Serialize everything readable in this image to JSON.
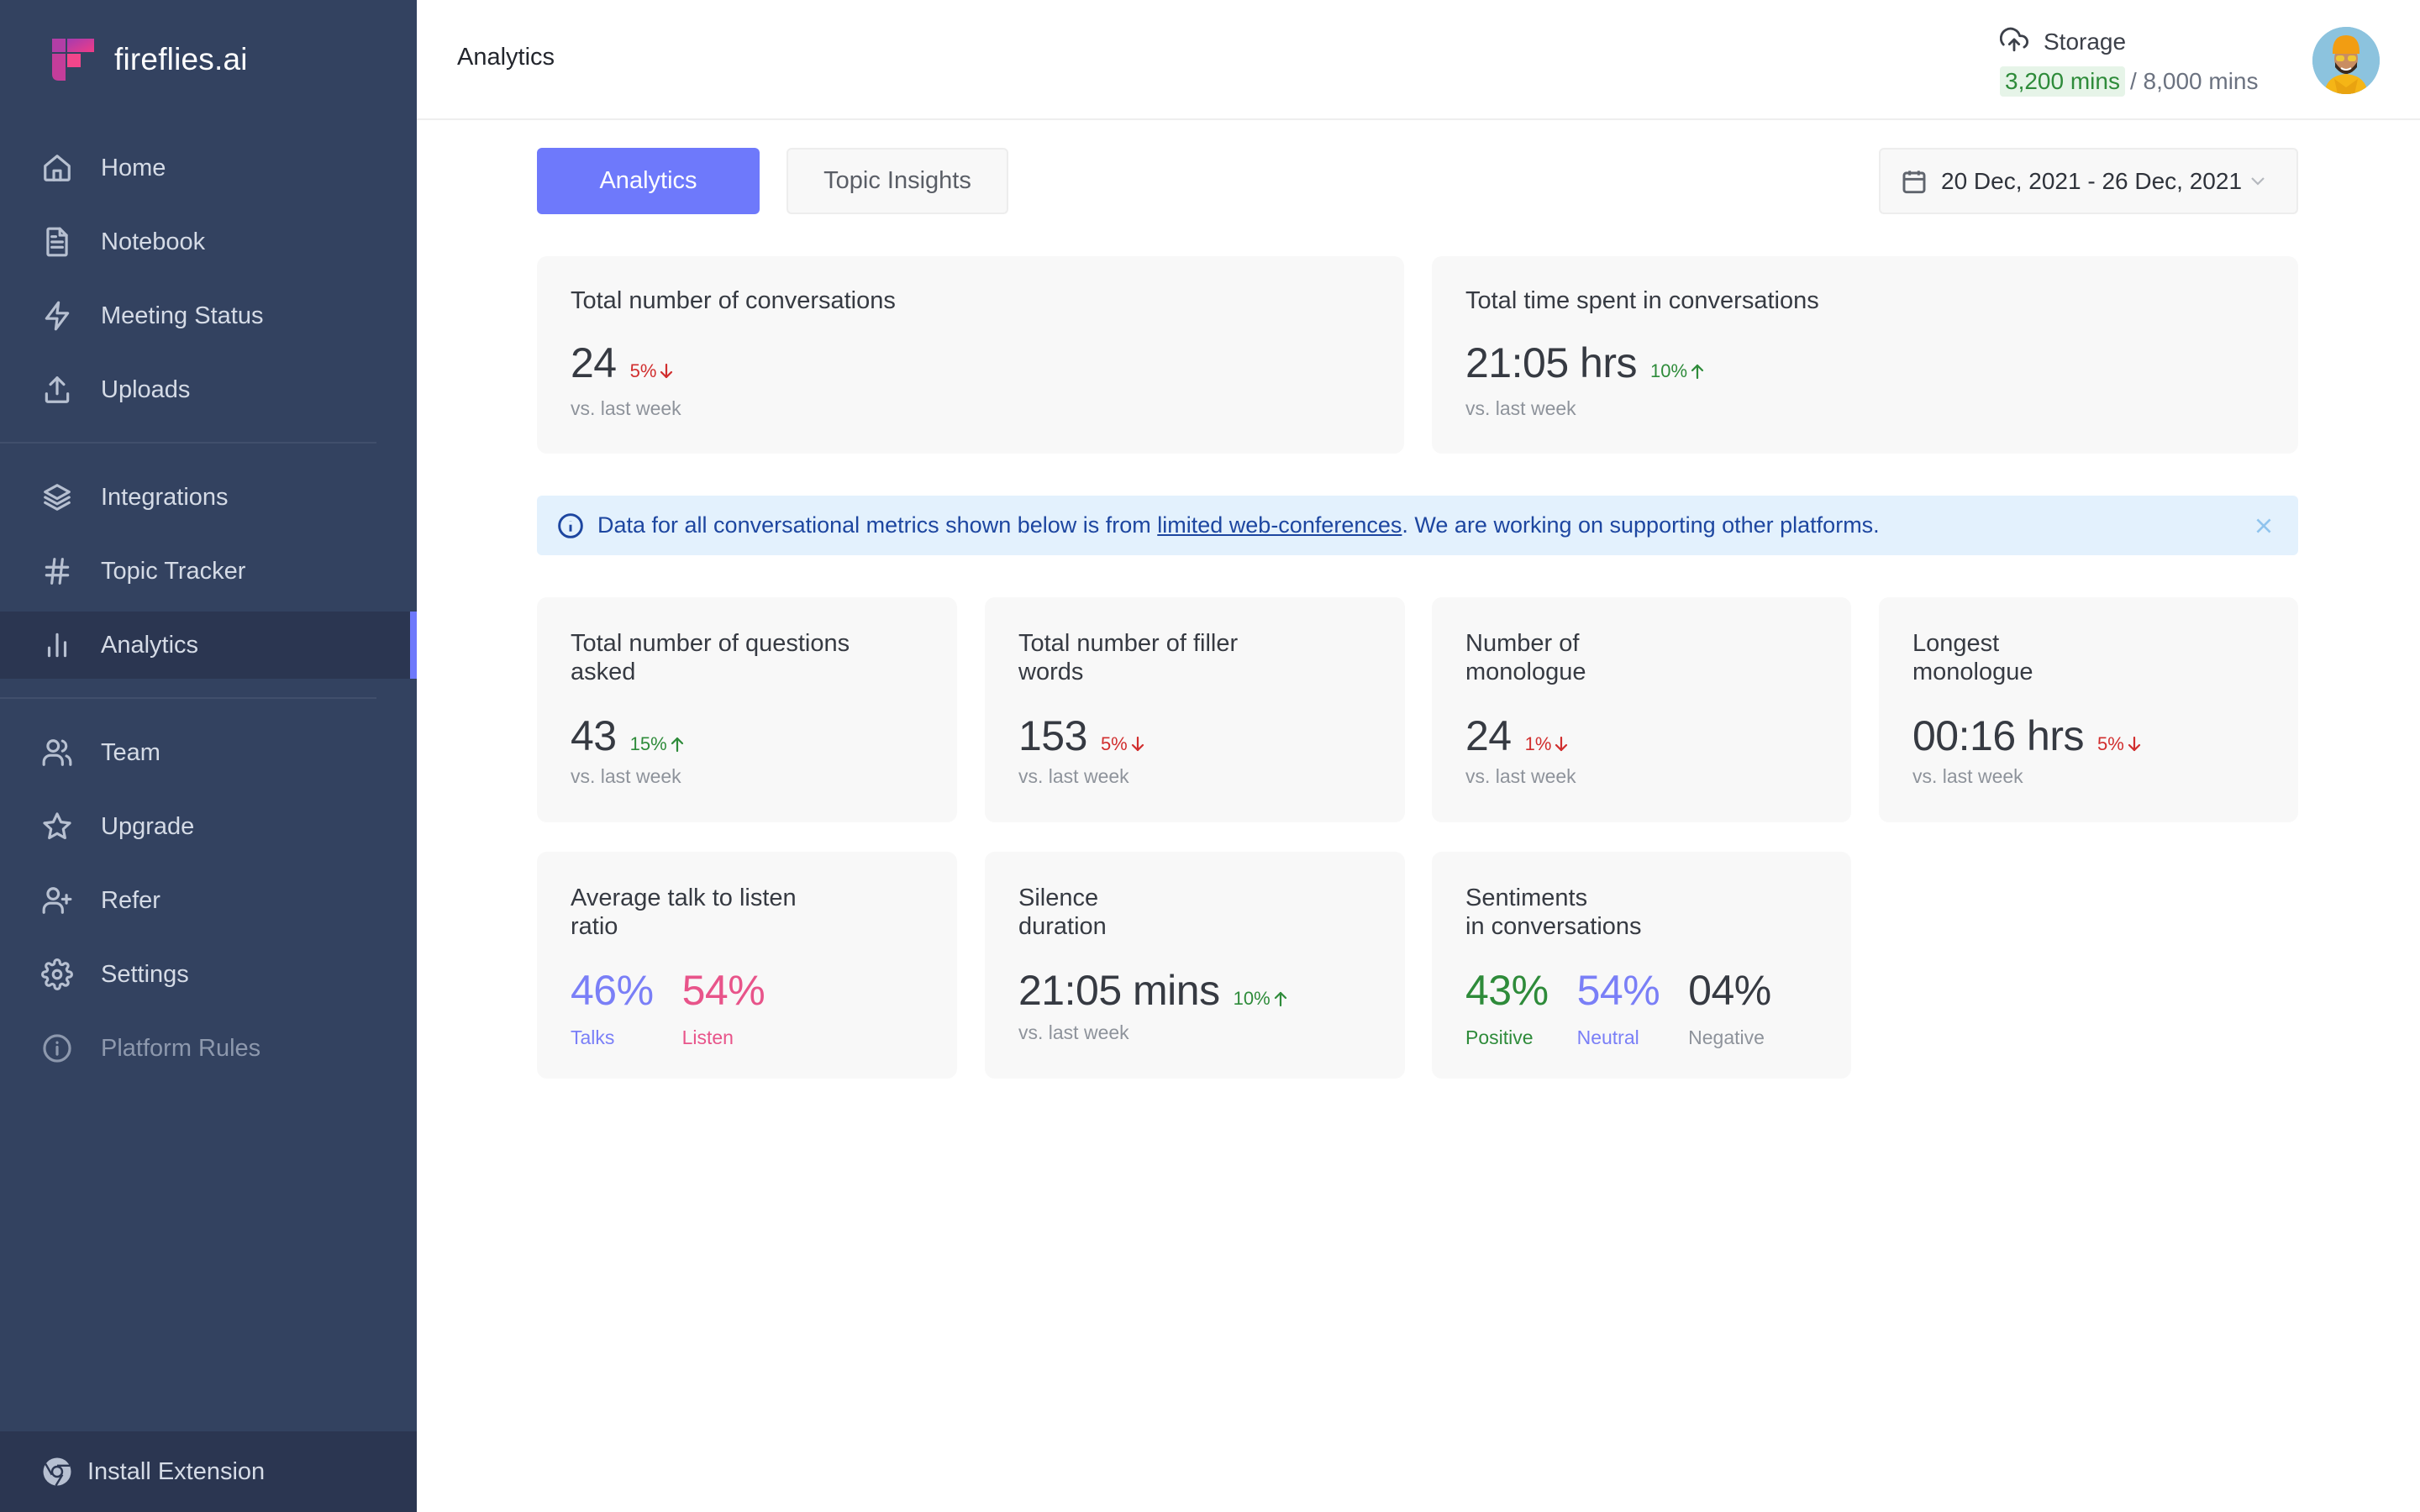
{
  "app": {
    "brand": "fireflies.ai"
  },
  "sidebar": {
    "items": [
      {
        "label": "Home",
        "icon": "home-icon"
      },
      {
        "label": "Notebook",
        "icon": "notebook-icon"
      },
      {
        "label": "Meeting Status",
        "icon": "lightning-icon"
      },
      {
        "label": "Uploads",
        "icon": "upload-icon"
      },
      {
        "label": "Integrations",
        "icon": "layers-icon"
      },
      {
        "label": "Topic Tracker",
        "icon": "hash-icon"
      },
      {
        "label": "Analytics",
        "icon": "bar-chart-icon",
        "active": true
      },
      {
        "label": "Team",
        "icon": "team-icon"
      },
      {
        "label": "Upgrade",
        "icon": "star-icon"
      },
      {
        "label": "Refer",
        "icon": "user-plus-icon"
      },
      {
        "label": "Settings",
        "icon": "gear-icon"
      },
      {
        "label": "Platform Rules",
        "icon": "info-icon"
      }
    ],
    "install_extension": "Install Extension"
  },
  "header": {
    "title": "Analytics",
    "storage": {
      "label": "Storage",
      "used": "3,200 mins",
      "total": "/ 8,000 mins"
    }
  },
  "tabs": [
    {
      "label": "Analytics",
      "active": true
    },
    {
      "label": "Topic Insights",
      "active": false
    }
  ],
  "date_range": "20 Dec, 2021 - 26 Dec, 2021",
  "summary_cards": [
    {
      "title": "Total number of conversations",
      "value": "24",
      "change": "5%",
      "direction": "down",
      "sub": "vs. last week"
    },
    {
      "title": "Total time spent in conversations",
      "value": "21:05 hrs",
      "change": "10%",
      "direction": "up",
      "sub": "vs. last week"
    }
  ],
  "banner": {
    "text_before": "Data for all conversational metrics shown below is from ",
    "link": "limited web-conferences",
    "text_after": ". We are working on supporting other platforms."
  },
  "metric_cards": [
    {
      "title_line1": "Total number of questions",
      "title_line2": "asked",
      "value": "43",
      "change": "15%",
      "direction": "up",
      "sub": "vs. last week"
    },
    {
      "title_line1": "Total number of filler",
      "title_line2": "words",
      "value": "153",
      "change": "5%",
      "direction": "down",
      "sub": "vs. last week"
    },
    {
      "title_line1": "Number of",
      "title_line2": "monologue",
      "value": "24",
      "change": "1%",
      "direction": "down",
      "sub": "vs. last week"
    },
    {
      "title_line1": "Longest",
      "title_line2": "monologue",
      "value": "00:16 hrs",
      "change": "5%",
      "direction": "down",
      "sub": "vs. last week"
    }
  ],
  "talk_listen": {
    "title_line1": "Average talk to listen",
    "title_line2": "ratio",
    "talks": {
      "value": "46%",
      "label": "Talks",
      "color": "#7a7ff7"
    },
    "listen": {
      "value": "54%",
      "label": "Listen",
      "color": "#e8548a"
    }
  },
  "silence": {
    "title_line1": "Silence",
    "title_line2": "duration",
    "value": "21:05 mins",
    "change": "10%",
    "direction": "up",
    "sub": "vs. last week"
  },
  "sentiments": {
    "title_line1": "Sentiments",
    "title_line2": "in conversations",
    "positive": {
      "value": "43%",
      "label": "Positive",
      "color": "#2e8b3a"
    },
    "neutral": {
      "value": "54%",
      "label": "Neutral",
      "color": "#7a7ff7"
    },
    "negative": {
      "value": "04%",
      "label": "Negative",
      "color": "#363a42",
      "label_color": "#8e939b"
    }
  },
  "colors": {
    "sidebar_bg": "#334260",
    "accent": "#6e79fb",
    "up": "#2e8b3a",
    "down": "#d12e2e"
  }
}
